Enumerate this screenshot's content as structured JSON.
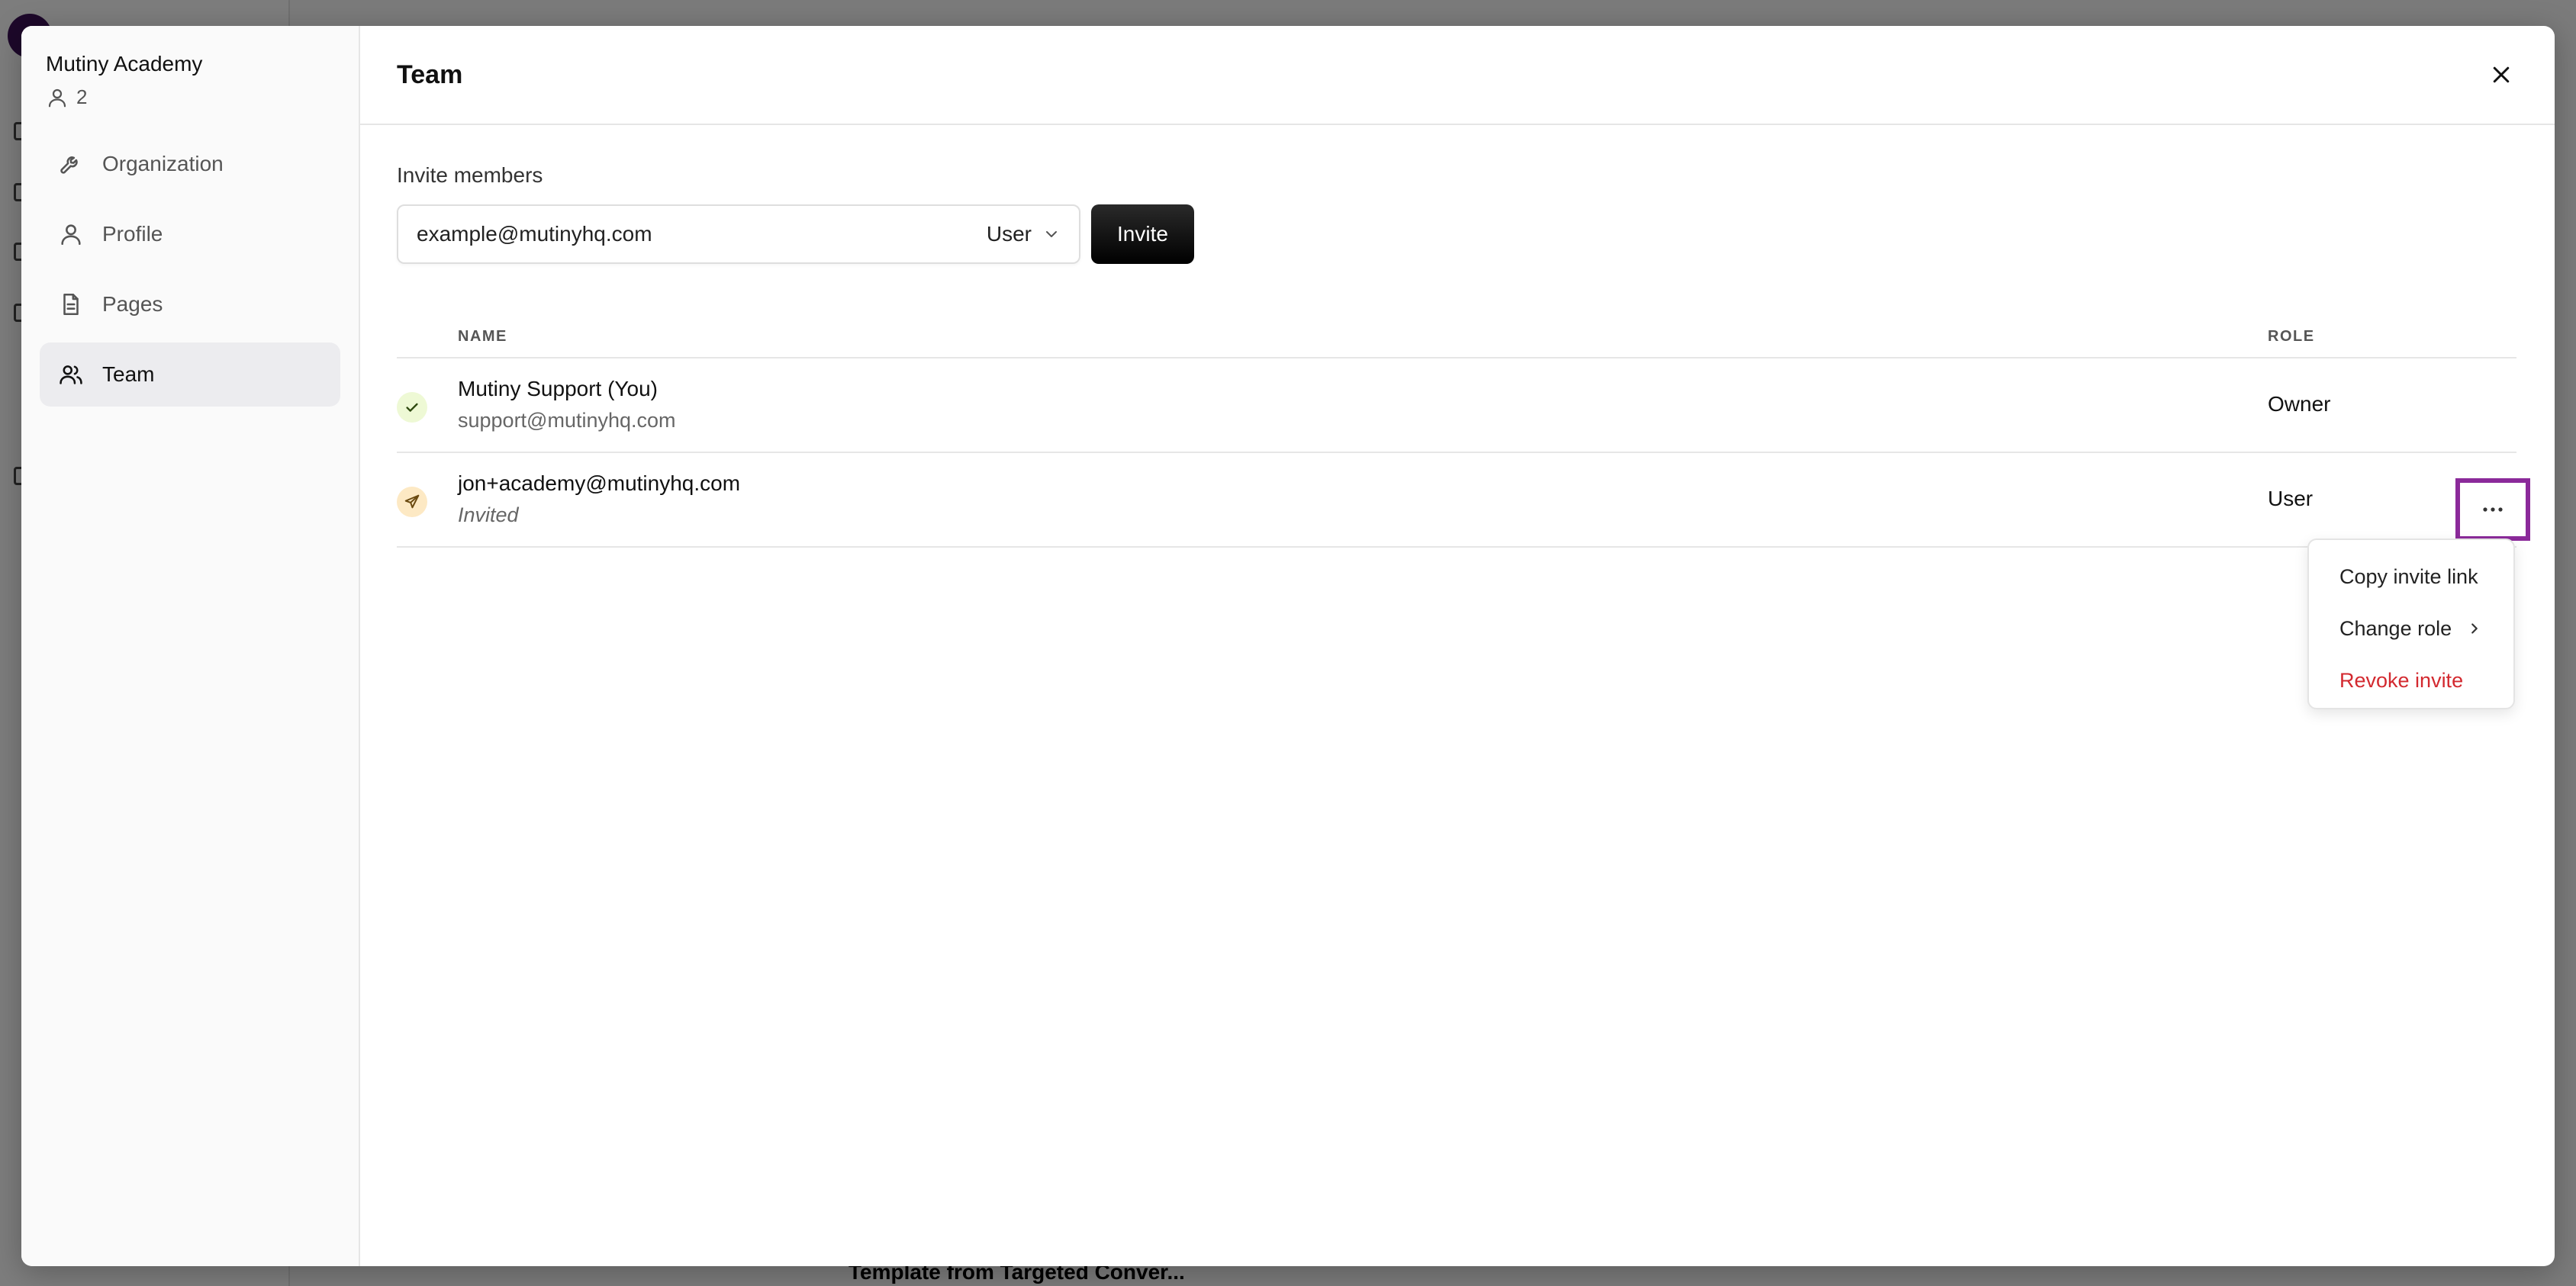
{
  "background": {
    "footer_text": "Template from Targeted Conver..."
  },
  "sidebar": {
    "org_name": "Mutiny Academy",
    "member_count": "2",
    "items": [
      {
        "label": "Organization",
        "icon": "wrench-icon"
      },
      {
        "label": "Profile",
        "icon": "user-icon"
      },
      {
        "label": "Pages",
        "icon": "document-icon"
      },
      {
        "label": "Team",
        "icon": "users-icon",
        "active": true
      }
    ]
  },
  "header": {
    "title": "Team"
  },
  "invite": {
    "label": "Invite members",
    "placeholder": "example@mutinyhq.com",
    "role": "User",
    "button": "Invite"
  },
  "table": {
    "headers": {
      "name": "NAME",
      "role": "ROLE"
    },
    "rows": [
      {
        "name": "Mutiny Support (You)",
        "sub": "support@mutinyhq.com",
        "role": "Owner",
        "status": "accepted"
      },
      {
        "name": "jon+academy@mutinyhq.com",
        "sub": "Invited",
        "role": "User",
        "status": "invited"
      }
    ]
  },
  "menu": {
    "items": [
      {
        "label": "Copy invite link"
      },
      {
        "label": "Change role"
      },
      {
        "label": "Revoke invite"
      }
    ]
  },
  "colors": {
    "accent_highlight": "#8b2a9a",
    "danger": "#d3292f",
    "status_ok_bg": "#eef9d5",
    "status_pending_bg": "#fde9c4"
  }
}
